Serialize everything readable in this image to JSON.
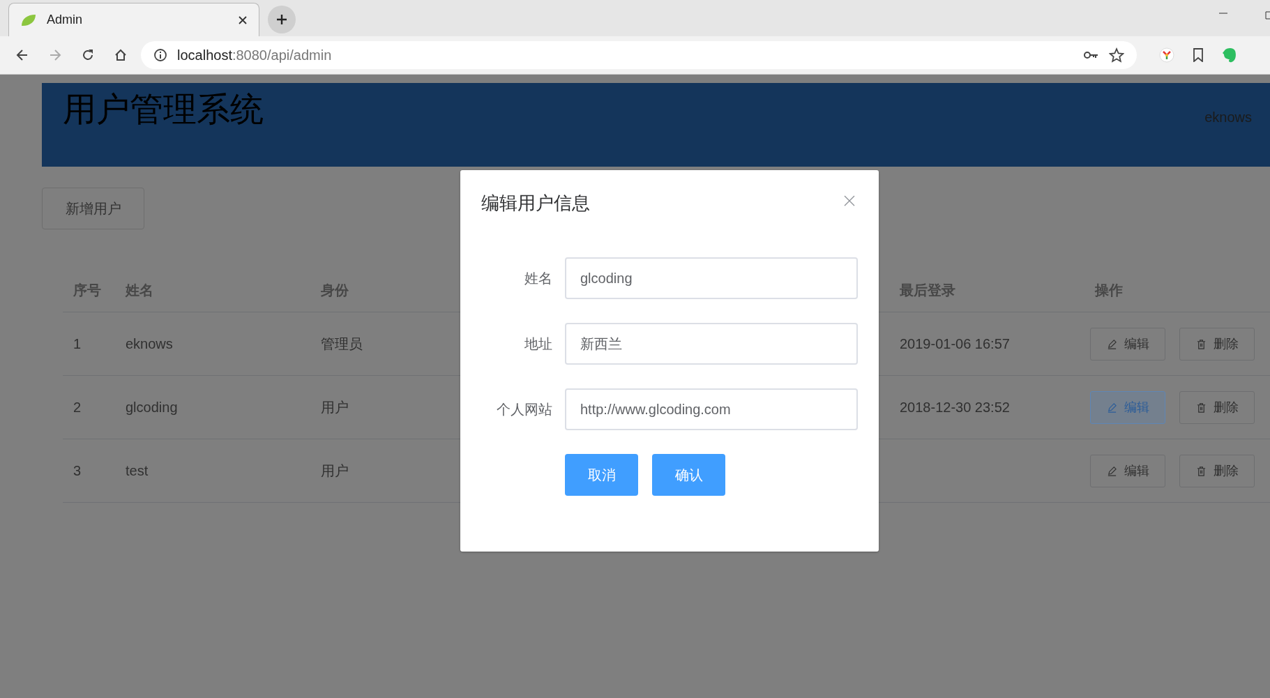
{
  "browser": {
    "tab_title": "Admin",
    "url_host": "localhost",
    "url_path": ":8080/api/admin"
  },
  "header": {
    "title": "用户管理系统",
    "user": "eknows"
  },
  "add_button": "新增用户",
  "table": {
    "columns": [
      "序号",
      "姓名",
      "身份",
      "最后登录",
      "操作"
    ],
    "rows": [
      {
        "index": "1",
        "name": "eknows",
        "role": "管理员",
        "last_login": "2019-01-06 16:57",
        "actions": [
          {
            "kind": "edit",
            "label": "编辑",
            "focused": false
          },
          {
            "kind": "delete",
            "label": "删除",
            "focused": false
          }
        ]
      },
      {
        "index": "2",
        "name": "glcoding",
        "role": "用户",
        "last_login": "2018-12-30 23:52",
        "actions": [
          {
            "kind": "edit",
            "label": "编辑",
            "focused": true
          },
          {
            "kind": "delete",
            "label": "删除",
            "focused": false
          }
        ]
      },
      {
        "index": "3",
        "name": "test",
        "role": "用户",
        "actions": [
          {
            "kind": "edit",
            "label": "编辑",
            "focused": false
          },
          {
            "kind": "delete",
            "label": "删除",
            "focused": false
          }
        ]
      }
    ]
  },
  "dialog": {
    "title": "编辑用户信息",
    "fields": [
      {
        "label": "姓名",
        "value": "glcoding"
      },
      {
        "label": "地址",
        "value": "新西兰"
      },
      {
        "label": "个人网站",
        "value": "http://www.glcoding.com"
      }
    ],
    "buttons": [
      "取消",
      "确认"
    ]
  }
}
